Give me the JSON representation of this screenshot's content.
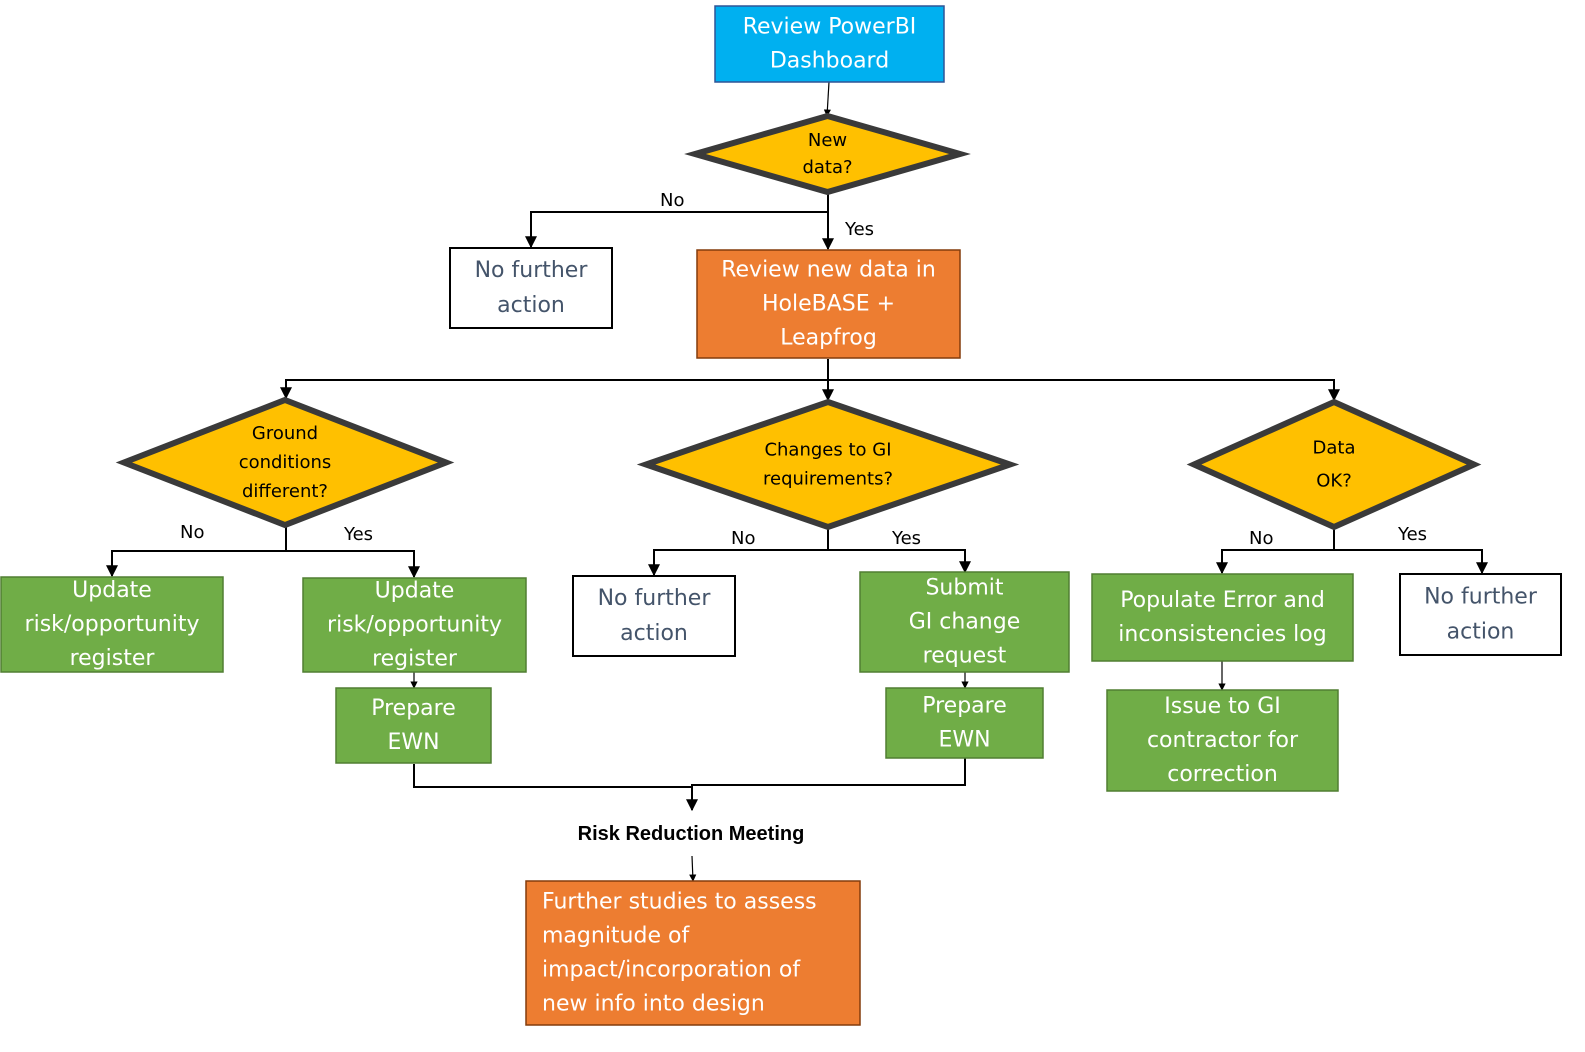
{
  "colors": {
    "blue": "#00B0F0",
    "blue_border": "#2F5597",
    "orange": "#ED7D31",
    "orange_border": "#843C0C",
    "green": "#70AD47",
    "green_border": "#507E32",
    "yellow": "#FFC000",
    "diamond_border": "#3A3A3A",
    "white_box_text": "#44546A"
  },
  "nodes": {
    "start": {
      "lines": [
        "Review PowerBI",
        "Dashboard"
      ]
    },
    "new_data": {
      "lines": [
        "New",
        "data?"
      ]
    },
    "no_action_1": {
      "lines": [
        "No further",
        "action"
      ]
    },
    "review_data": {
      "lines": [
        "Review new data in",
        "HoleBASE +",
        "Leapfrog"
      ]
    },
    "ground_cond": {
      "lines": [
        "Ground",
        "conditions",
        "different?"
      ]
    },
    "changes_gi": {
      "lines": [
        "Changes to GI",
        "requirements?"
      ]
    },
    "data_ok": {
      "lines": [
        "Data",
        "OK?"
      ]
    },
    "update_reg_no": {
      "lines": [
        "Update",
        "risk/opportunity",
        "register"
      ]
    },
    "update_reg_yes": {
      "lines": [
        "Update",
        "risk/opportunity",
        "register"
      ]
    },
    "prepare_ewn_1": {
      "lines": [
        "Prepare",
        "EWN"
      ]
    },
    "no_action_2": {
      "lines": [
        "No further",
        "action"
      ]
    },
    "submit_gi": {
      "lines": [
        "Submit",
        "GI change",
        "request"
      ]
    },
    "prepare_ewn_2": {
      "lines": [
        "Prepare",
        "EWN"
      ]
    },
    "populate_log": {
      "lines": [
        "Populate Error and",
        "inconsistencies log"
      ]
    },
    "issue_contractor": {
      "lines": [
        "Issue to GI",
        "contractor for",
        "correction"
      ]
    },
    "no_action_3": {
      "lines": [
        "No further",
        "action"
      ]
    },
    "risk_meeting": {
      "label": "Risk Reduction Meeting"
    },
    "further_studies": {
      "lines": [
        "Further studies to assess",
        "magnitude of",
        "impact/incorporation of",
        "new info into design"
      ]
    }
  },
  "edge_labels": {
    "new_data_no": "No",
    "new_data_yes": "Yes",
    "ground_no": "No",
    "ground_yes": "Yes",
    "gi_no": "No",
    "gi_yes": "Yes",
    "ok_no": "No",
    "ok_yes": "Yes"
  }
}
